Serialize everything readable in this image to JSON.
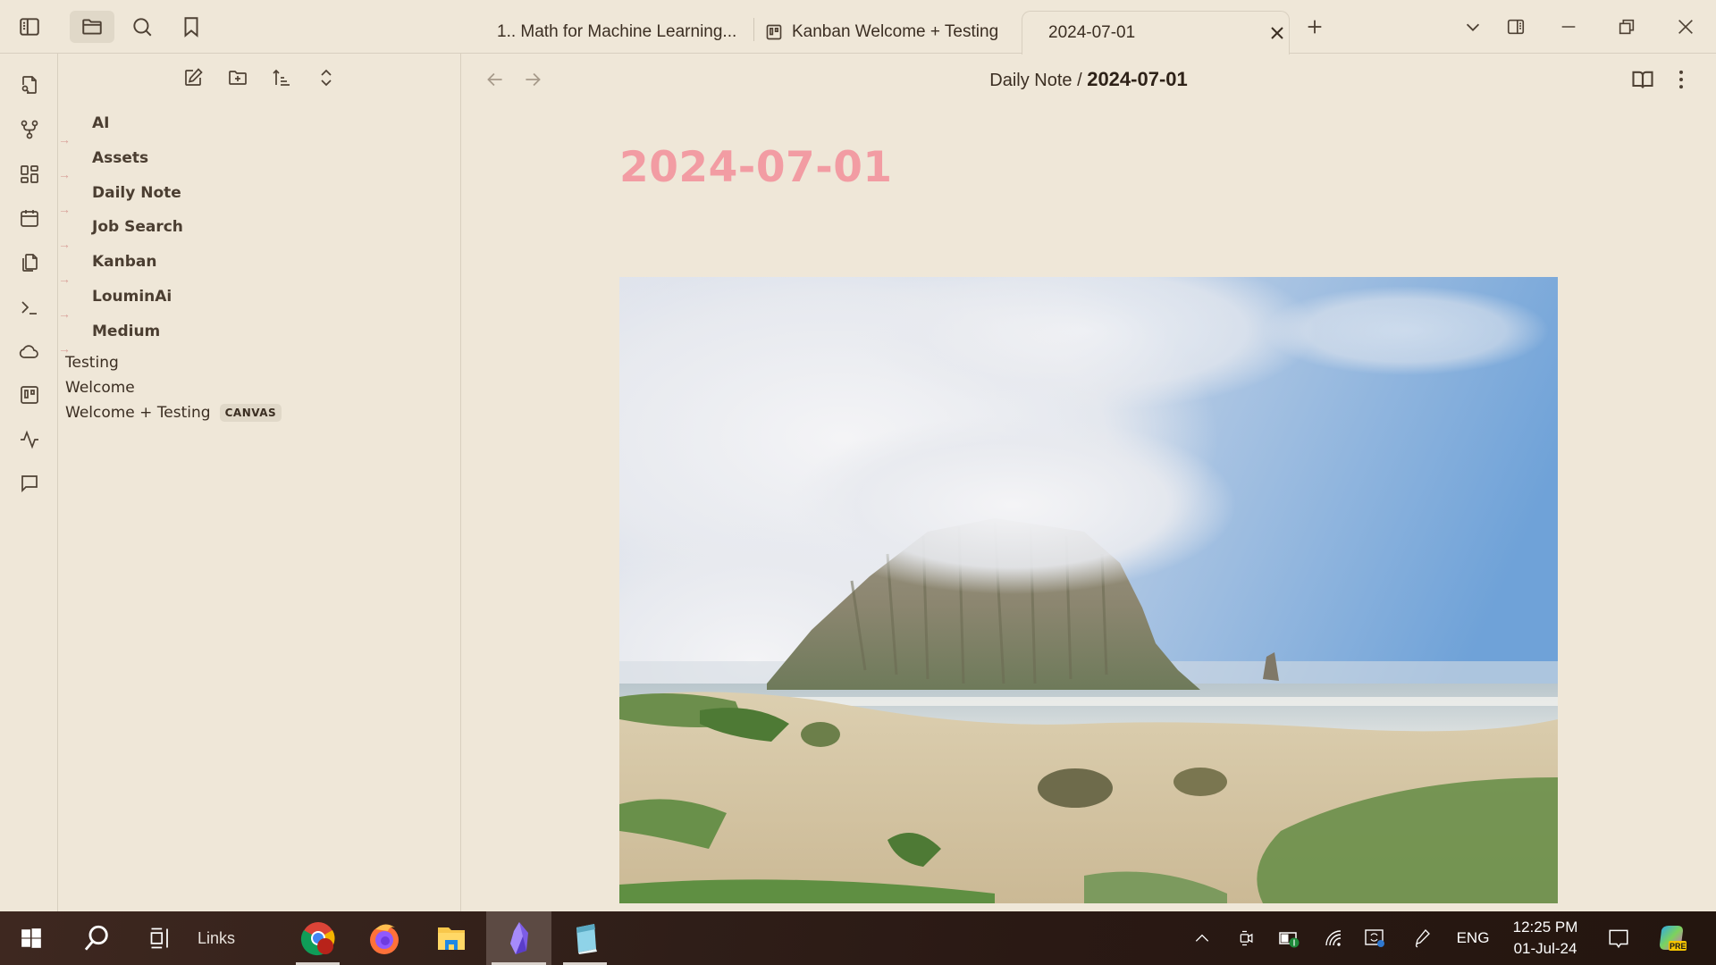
{
  "header": {
    "left_buttons": [
      {
        "name": "toggle-sidebar",
        "icon": "sidebar-left-icon"
      },
      {
        "name": "file-explorer",
        "icon": "folder-icon",
        "active": true
      },
      {
        "name": "search",
        "icon": "search-icon"
      },
      {
        "name": "bookmarks",
        "icon": "bookmark-icon"
      }
    ]
  },
  "ribbon": {
    "items": [
      {
        "name": "open-quick-switcher",
        "icon": "file-search-icon"
      },
      {
        "name": "open-graph-view",
        "icon": "graph-icon"
      },
      {
        "name": "open-canvas",
        "icon": "layout-dashboard-icon"
      },
      {
        "name": "open-daily-note",
        "icon": "calendar-icon"
      },
      {
        "name": "insert-template",
        "icon": "copy-icon"
      },
      {
        "name": "open-command-palette",
        "icon": "terminal-icon"
      },
      {
        "name": "sync",
        "icon": "cloud-icon"
      },
      {
        "name": "create-kanban-board",
        "icon": "kanban-icon"
      },
      {
        "name": "activity",
        "icon": "activity-icon"
      },
      {
        "name": "comments",
        "icon": "message-square-icon"
      }
    ]
  },
  "sidebar": {
    "toolbar": [
      {
        "name": "new-note",
        "icon": "edit-icon"
      },
      {
        "name": "new-folder",
        "icon": "folder-plus-icon"
      },
      {
        "name": "change-sort-order",
        "icon": "sort-icon"
      },
      {
        "name": "expand-all",
        "icon": "chevrons-up-down-icon"
      }
    ],
    "folders": [
      "AI",
      "Assets",
      "Daily Note",
      "Job Search",
      "Kanban",
      "LouminAi",
      "Medium"
    ],
    "folder_arrow_glyph": "→",
    "files": [
      {
        "name": "Testing"
      },
      {
        "name": "Welcome"
      },
      {
        "name": "Welcome + Testing",
        "badge": "CANVAS"
      }
    ]
  },
  "tabs": [
    {
      "label": "1.. Math for Machine Learning...",
      "icon": null,
      "active": false
    },
    {
      "label": "Kanban Welcome + Testing",
      "icon": "kanban-icon",
      "active": false
    },
    {
      "label": "2024-07-01",
      "icon": null,
      "active": true
    }
  ],
  "tabbar": {
    "new_tab_icon": "plus-icon",
    "tab_list_icon": "chevron-down-icon",
    "right_sidebar_icon": "sidebar-right-icon",
    "window_controls": [
      "minimize-icon",
      "restore-icon",
      "close-icon"
    ]
  },
  "view": {
    "breadcrumb_parent": "Daily Note",
    "breadcrumb_separator": "/",
    "breadcrumb_current": "2024-07-01",
    "back_icon": "arrow-left-icon",
    "forward_icon": "arrow-right-icon",
    "reading_view_icon": "book-open-icon",
    "more_options_icon": "more-vertical-icon"
  },
  "note": {
    "title": "2024-07-01",
    "title_color": "#F29CA3",
    "image_alt": "Morro Rock shrouded in fog above sand dunes and beach"
  },
  "taskbar": {
    "start_icon": "windows-icon",
    "search_icon": "search-icon",
    "task_view_icon": "task-view-icon",
    "links_label": "Links",
    "apps": [
      {
        "name": "Google Chrome",
        "icon": "chrome-icon",
        "running": true,
        "active": false
      },
      {
        "name": "Firefox",
        "icon": "firefox-icon",
        "running": false,
        "active": false
      },
      {
        "name": "File Explorer",
        "icon": "file-explorer-icon",
        "running": false,
        "active": false
      },
      {
        "name": "Obsidian",
        "icon": "obsidian-icon",
        "running": true,
        "active": true
      },
      {
        "name": "Notepad",
        "icon": "notepad-icon",
        "running": true,
        "active": false
      }
    ],
    "tray": {
      "show_hidden_icon": "chevron-up-icon",
      "icons": [
        "camera-icon",
        "battery-saver-icon",
        "wifi-icon",
        "remote-icon",
        "pen-icon"
      ],
      "language": "ENG",
      "time": "12:25 PM",
      "date": "01-Jul-24",
      "notifications_icon": "notification-icon",
      "copilot_badge": "PRE"
    }
  }
}
